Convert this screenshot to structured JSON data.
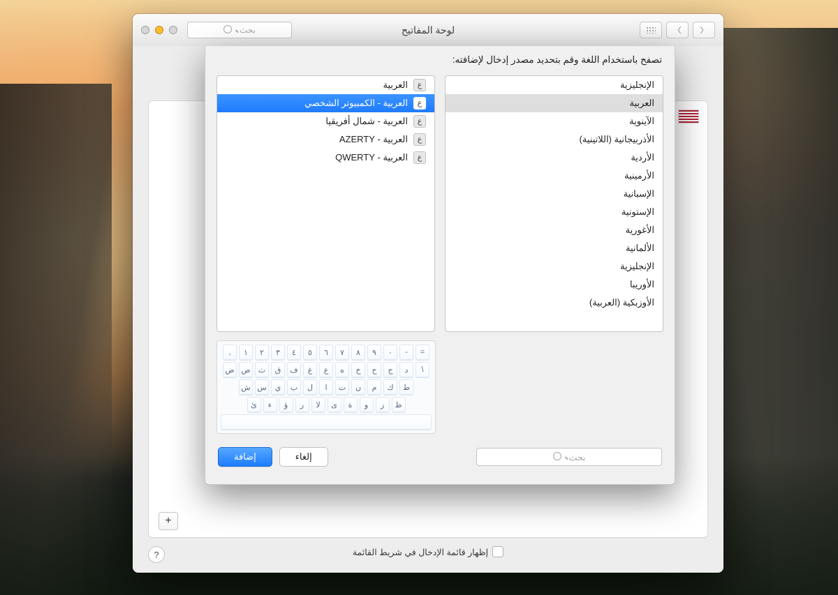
{
  "window": {
    "title": "لوحة المفاتيح",
    "toolbar_search_placeholder": "بحث",
    "show_menu_checkbox": "إظهار قائمة الإدخال في شريط القائمة"
  },
  "sheet": {
    "header": "تصفح باستخدام اللغة وقم بتحديد مصدر إدخال لإضافته:",
    "languages": [
      "الإنجليزية",
      "العربية",
      "الآينوية",
      "الأذربيجانية (اللاتينية)",
      "الأردية",
      "الأرمينية",
      "الإسبانية",
      "الإستونية",
      "الأغورية",
      "الألمانية",
      "الإنجليزية",
      "الأوريبا",
      "الأوزبكية (العربية)"
    ],
    "selected_language_index": 1,
    "keyboards": [
      "العربية",
      "العربية - الكمبيوتر الشخصي",
      "العربية - شمال أفريقيا",
      "العربية - AZERTY",
      "العربية - QWERTY"
    ],
    "keyboard_icon_glyph": "ع",
    "selected_keyboard_index": 1,
    "search_placeholder": "بحث",
    "add_button": "إضافة",
    "cancel_button": "إلغاء"
  },
  "keyboard_preview": {
    "row1": [
      ",",
      "١",
      "٢",
      "٣",
      "٤",
      "٥",
      "٦",
      "٧",
      "٨",
      "٩",
      "٠",
      "-",
      "="
    ],
    "row2": [
      "ض",
      "ص",
      "ث",
      "ق",
      "ف",
      "غ",
      "ع",
      "ه",
      "خ",
      "ح",
      "ج",
      "د",
      "\\"
    ],
    "row3": [
      "ش",
      "س",
      "ي",
      "ب",
      "ل",
      "ا",
      "ت",
      "ن",
      "م",
      "ك",
      "ط"
    ],
    "row4": [
      "ئ",
      "ء",
      "ؤ",
      "ر",
      "لا",
      "ى",
      "ة",
      "و",
      "ز",
      "ظ"
    ]
  }
}
